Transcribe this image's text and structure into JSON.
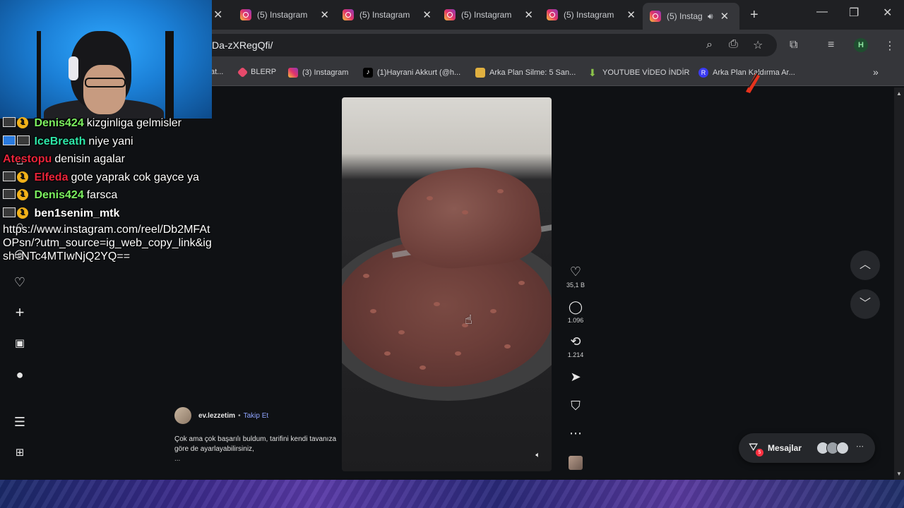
{
  "browser": {
    "tabs": [
      {
        "label": "(5) Instagram"
      },
      {
        "label": "(5) Instagram"
      },
      {
        "label": "(5) Instagram"
      },
      {
        "label": "(5) Instagram"
      },
      {
        "label": "(5) Instagr"
      }
    ],
    "url_fragment": "Da-zXRegQfi/",
    "profile_initial": "H",
    "bookmarks": [
      {
        "label": "at...",
        "icon": "page-icon"
      },
      {
        "label": "BLERP",
        "icon": "blerp-icon",
        "color": "#e64a6b"
      },
      {
        "label": "(3) Instagram",
        "icon": "instagram-icon"
      },
      {
        "label": "(1)Hayrani Akkurt (@h...",
        "icon": "tiktok-icon"
      },
      {
        "label": "Arka Plan Silme: 5 San...",
        "icon": "layers-icon",
        "color": "#e0b040"
      },
      {
        "label": "YOUTUBE VİDEO İNDİR",
        "icon": "download-arrow-icon",
        "color": "#8bc34a"
      },
      {
        "label": "Arka Plan Kaldırma Ar...",
        "icon": "r-logo-icon",
        "color": "#3a3af0"
      }
    ]
  },
  "chat": [
    {
      "user": "Denis424",
      "user_color": "#7cf060",
      "message": "kizginliga gelmisler"
    },
    {
      "user": "IceBreath",
      "user_color": "#2ee6a8",
      "message": "niye yani"
    },
    {
      "user": "Atestopu",
      "user_color": "#e8243a",
      "message": "denisin agalar"
    },
    {
      "user": "Elfeda",
      "user_color": "#e8243a",
      "message": "gote yaprak cok gayce ya"
    },
    {
      "user": "Denis424",
      "user_color": "#7cf060",
      "message": "farsca"
    },
    {
      "user": "ben1senim_mtk",
      "user_color": "#ffffff",
      "message": "https://www.instagram.com/reel/Db2MFAtOPsn/?utm_source=ig_web_copy_link&igsh=NTc4MTIwNjQ2YQ=="
    }
  ],
  "reel": {
    "author": "ev.lezzetim",
    "separator": "•",
    "follow_label": "Takip Et",
    "caption": "Çok ama çok başarılı buldum, tarifini kendi tavanıza göre de ayarlayabilirsiniz,",
    "caption_more": "...",
    "likes": "35,1 B",
    "comments": "1.096",
    "reposts": "1.214"
  },
  "messages": {
    "label": "Mesajlar",
    "badge": "5"
  },
  "colors": {
    "page_bg": "#0f1114",
    "follow_link": "#8fa4ff",
    "badge": "#ff3040"
  }
}
